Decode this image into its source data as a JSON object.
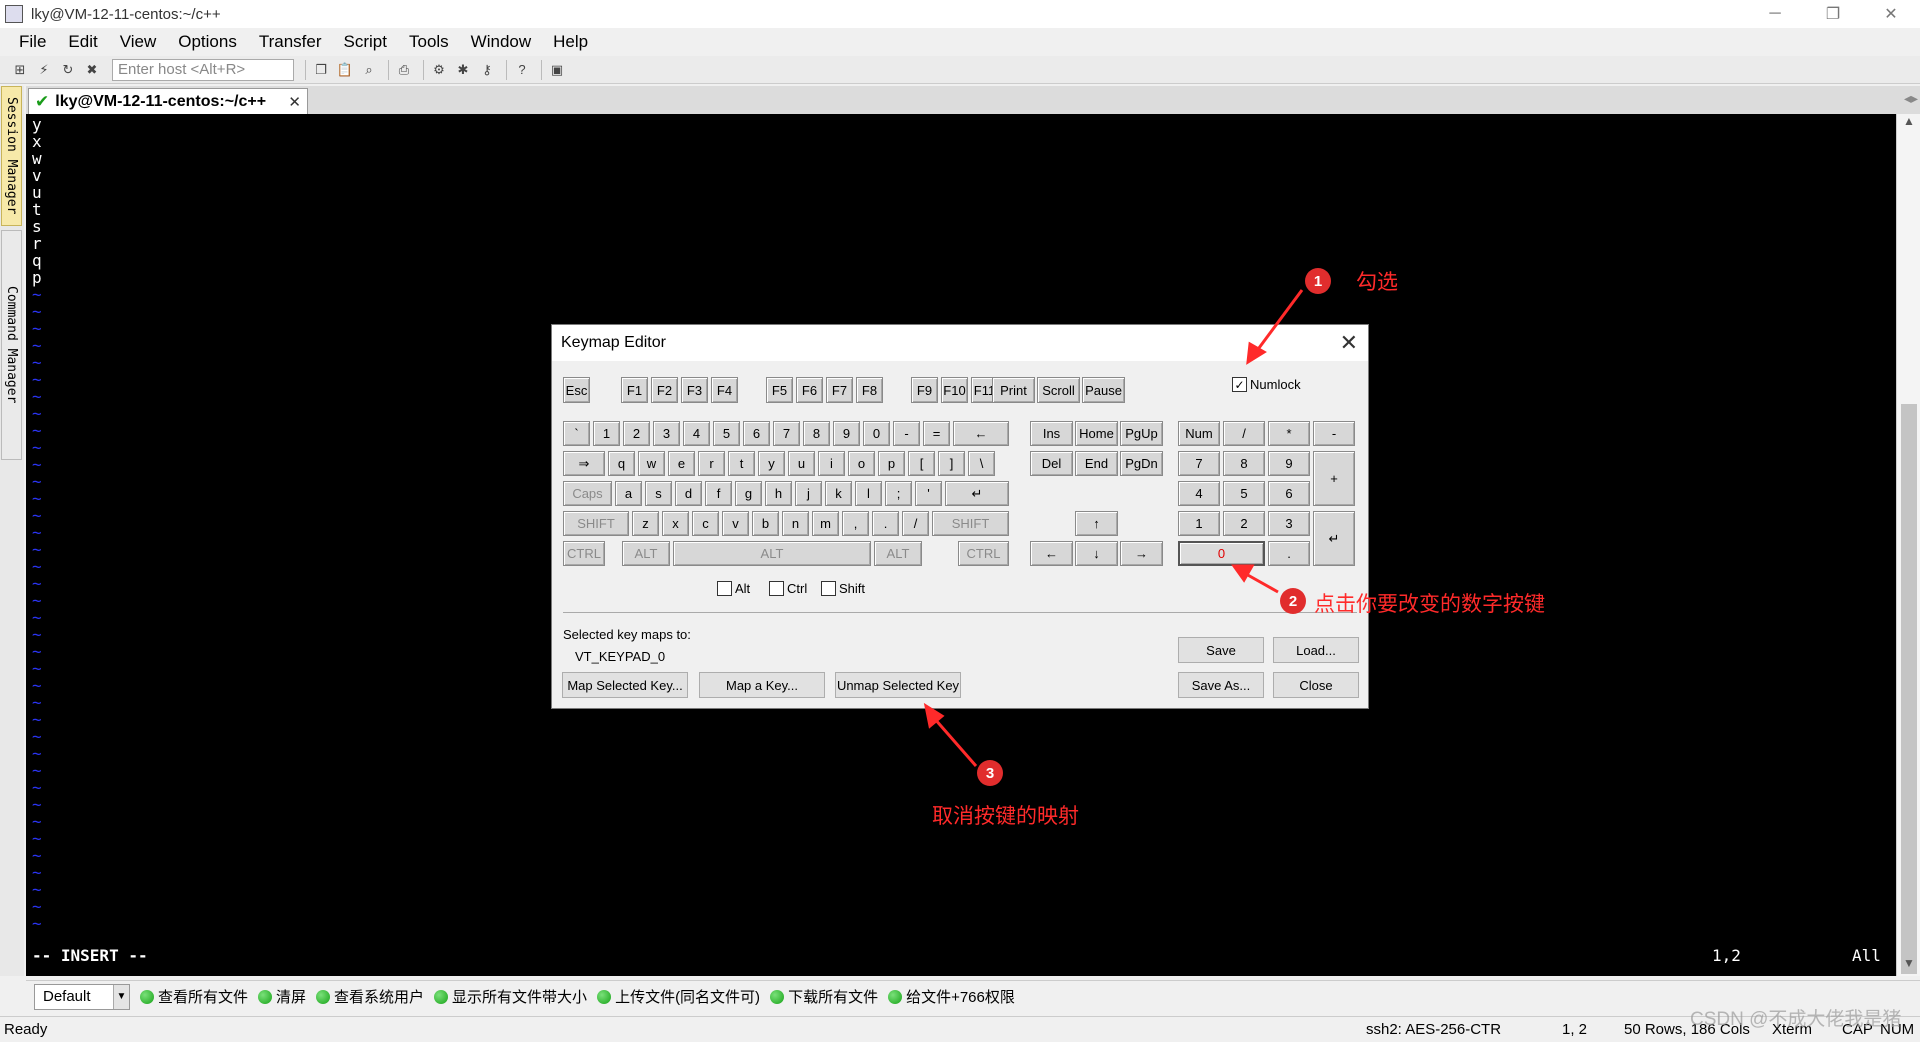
{
  "window": {
    "title": "lky@VM-12-11-centos:~/c++",
    "controls": [
      "─",
      "❐",
      "✕"
    ]
  },
  "menubar": [
    "File",
    "Edit",
    "View",
    "Options",
    "Transfer",
    "Script",
    "Tools",
    "Window",
    "Help"
  ],
  "toolbar": {
    "host_placeholder": "Enter host <Alt+R>"
  },
  "left_tabs": {
    "session": "Session Manager",
    "command": "Command Manager"
  },
  "session_tab": {
    "label": "lky@VM-12-11-centos:~/c++",
    "close": "✕"
  },
  "terminal": {
    "lines": [
      "y",
      "x",
      "w",
      "v",
      "u",
      "t",
      "s",
      "r",
      "q",
      "p"
    ],
    "tilde_count": 38,
    "tilde": "~",
    "mode": "-- INSERT --",
    "cursor": "1,2",
    "position": "All"
  },
  "button_bar": {
    "select": "Default",
    "buttons": [
      "查看所有文件",
      "清屏",
      "查看系统用户",
      "显示所有文件带大小",
      "上传文件(同名文件可)",
      "下载所有文件",
      "给文件+766权限"
    ]
  },
  "status_bar": {
    "ready": "Ready",
    "cipher": "ssh2: AES-256-CTR",
    "pos": "1,  2",
    "size": "50 Rows, 186 Cols",
    "term": "Xterm",
    "caps": "CAP",
    "num": "NUM"
  },
  "watermark": "CSDN @不成大佬我是猪",
  "dialog": {
    "title": "Keymap Editor",
    "close": "✕",
    "numlock_label": "Numlock",
    "numlock_checked": true,
    "modifiers": [
      "Alt",
      "Ctrl",
      "Shift"
    ],
    "maps_label": "Selected key maps to:",
    "maps_value": "VT_KEYPAD_0",
    "buttons": {
      "map_selected": "Map Selected Key...",
      "map_a_key": "Map a Key...",
      "unmap": "Unmap Selected Key",
      "save": "Save",
      "load": "Load...",
      "save_as": "Save As...",
      "close": "Close"
    },
    "keys": {
      "esc": "Esc",
      "f": [
        "F1",
        "F2",
        "F3",
        "F4",
        "F5",
        "F6",
        "F7",
        "F8",
        "F9",
        "F10",
        "F11",
        "F12"
      ],
      "print": "Print",
      "scroll": "Scroll",
      "pause": "Pause",
      "row1": [
        "`",
        "1",
        "2",
        "3",
        "4",
        "5",
        "6",
        "7",
        "8",
        "9",
        "0",
        "-",
        "="
      ],
      "backspace": "←",
      "tab": "⇒",
      "row2": [
        "q",
        "w",
        "e",
        "r",
        "t",
        "y",
        "u",
        "i",
        "o",
        "p",
        "[",
        "]",
        "\\"
      ],
      "caps": "Caps",
      "row3": [
        "a",
        "s",
        "d",
        "f",
        "g",
        "h",
        "j",
        "k",
        "l",
        ";",
        "'"
      ],
      "enter": "↵",
      "shift": "SHIFT",
      "row4": [
        "z",
        "x",
        "c",
        "v",
        "b",
        "n",
        "m",
        ",",
        ".",
        "/"
      ],
      "ctrl": "CTRL",
      "alt": "ALT",
      "ins": "Ins",
      "home": "Home",
      "pgup": "PgUp",
      "del": "Del",
      "end": "End",
      "pgdn": "PgDn",
      "up": "↑",
      "left": "←",
      "down": "↓",
      "right": "→",
      "num": "Num",
      "div": "/",
      "mul": "*",
      "minus": "-",
      "n7": "7",
      "n8": "8",
      "n9": "9",
      "plus": "+",
      "n4": "4",
      "n5": "5",
      "n6": "6",
      "n1": "1",
      "n2": "2",
      "n3": "3",
      "nenter": "↵",
      "n0": "0",
      "ndot": "."
    }
  },
  "annotations": {
    "a1": {
      "num": "1",
      "text": "勾选"
    },
    "a2": {
      "num": "2",
      "text": "点击你要改变的数字按键"
    },
    "a3": {
      "num": "3",
      "text": "取消按键的映射"
    },
    "color": "#ff2a2a"
  }
}
